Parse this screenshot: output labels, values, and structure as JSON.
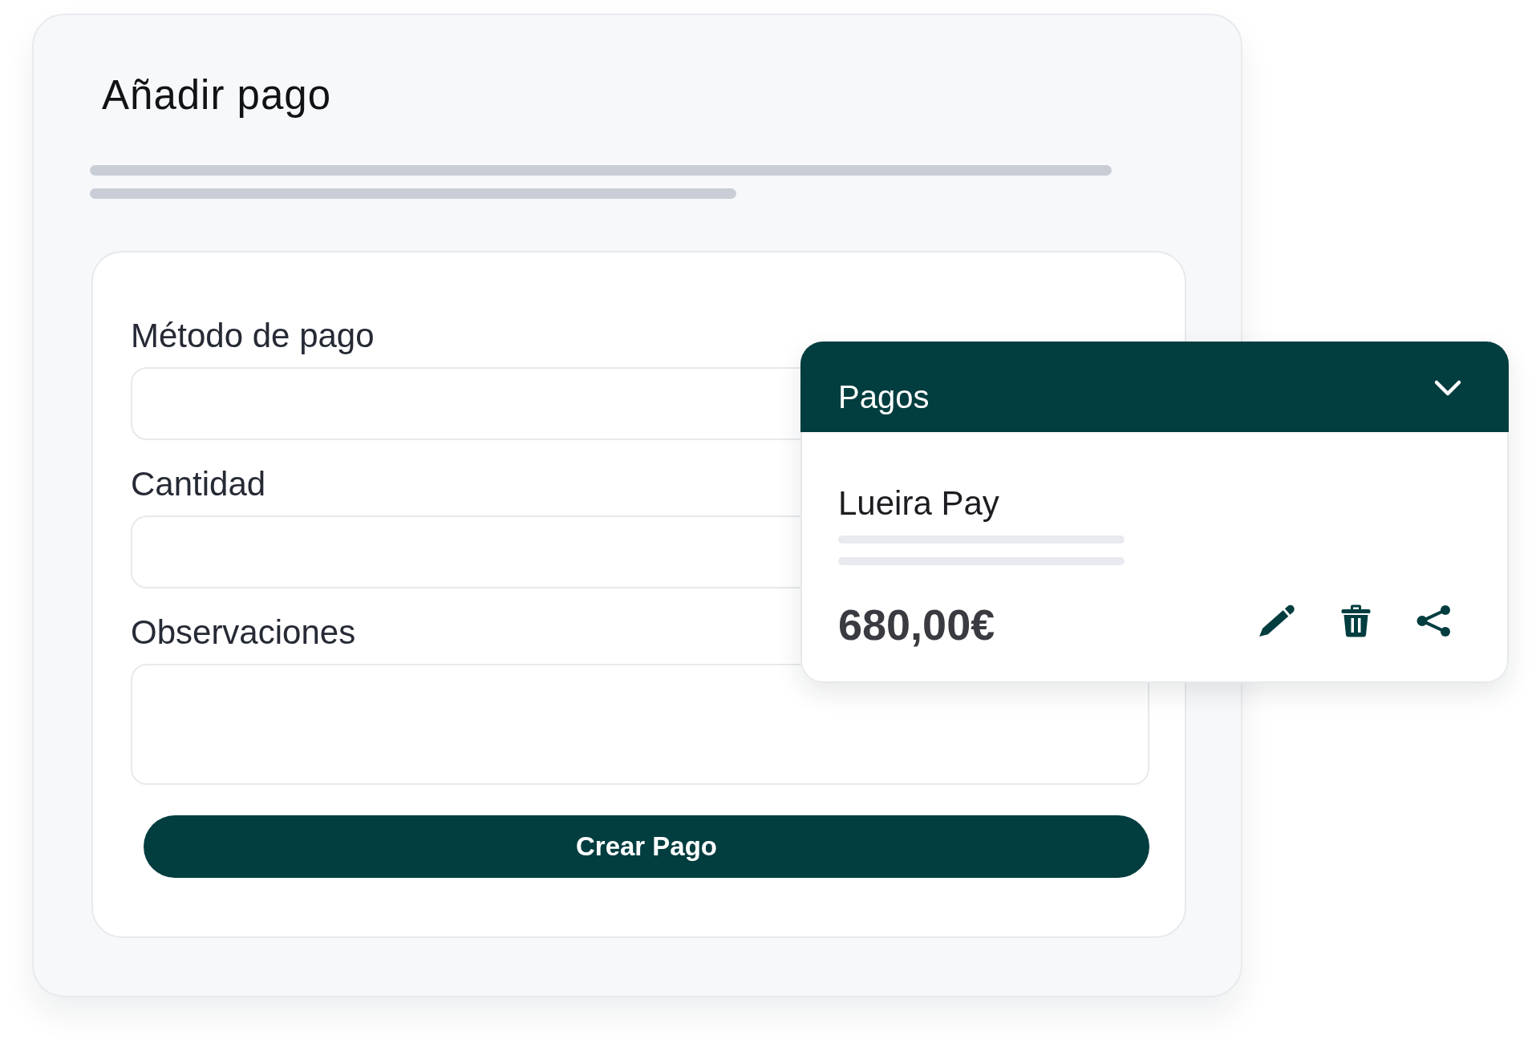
{
  "panel": {
    "title": "Añadir pago"
  },
  "form": {
    "fields": [
      {
        "label": "Método de pago",
        "kind": "input"
      },
      {
        "label": "Cantidad",
        "kind": "input"
      },
      {
        "label": "Observaciones",
        "kind": "textarea"
      }
    ],
    "submit_button": "Crear Pago"
  },
  "payments_card": {
    "title": "Pagos",
    "entry": {
      "name": "Lueira Pay",
      "amount": "680,00€",
      "actions": [
        {
          "kind": "edit"
        },
        {
          "kind": "delete"
        },
        {
          "kind": "share"
        }
      ]
    }
  }
}
